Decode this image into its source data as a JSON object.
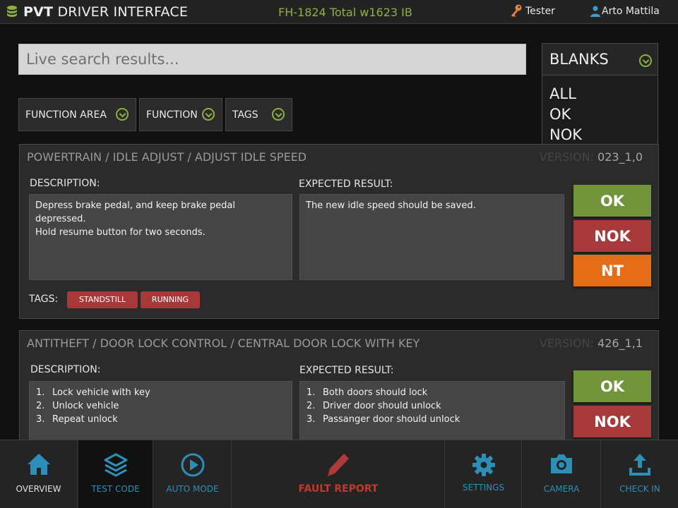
{
  "header": {
    "app_title_bold": "PVT",
    "app_title_rest": "DRIVER INTERFACE",
    "document": "FH-1824 Total w1623 IB",
    "role": "Tester",
    "user": "Arto Mattila"
  },
  "search": {
    "placeholder": "Live search results..."
  },
  "blanks": {
    "selected": "BLANKS",
    "options": [
      "ALL",
      "OK",
      "NOK"
    ]
  },
  "filters": [
    "FUNCTION AREA",
    "FUNCTION",
    "TAGS"
  ],
  "cards": [
    {
      "title": "POWERTRAIN / IDLE ADJUST / ADJUST IDLE SPEED",
      "version_label": "VERSION:",
      "version": "023_1,0",
      "description_label": "DESCRIPTION:",
      "description": [
        "Depress brake pedal, and keep brake pedal depressed.",
        "Hold resume button for two seconds."
      ],
      "expected_label": "EXPECTED RESULT:",
      "expected": "The new idle speed should be saved.",
      "buttons": [
        "OK",
        "NOK",
        "NT"
      ],
      "tags_label": "TAGS:",
      "tags": [
        "STANDSTILL",
        "RUNNING"
      ]
    },
    {
      "title": "ANTITHEFT /  DOOR LOCK CONTROL / CENTRAL DOOR LOCK WITH KEY",
      "version_label": "VERSION:",
      "version": "426_1,1",
      "description_label": "DESCRIPTION:",
      "description_items": [
        {
          "n": "1.",
          "text": "Lock vehicle with key"
        },
        {
          "n": "2.",
          "text": "Unlock vehicle"
        },
        {
          "n": "3.",
          "text": "Repeat unlock"
        }
      ],
      "expected_label": "EXPECTED RESULT:",
      "expected_items": [
        {
          "n": "1.",
          "text": "Both doors should lock"
        },
        {
          "n": "2.",
          "text": "Driver door  should unlock"
        },
        {
          "n": "3.",
          "text": "Passanger door should unlock"
        }
      ],
      "buttons": [
        "OK",
        "NOK"
      ]
    }
  ],
  "nav": [
    {
      "label": "OVERVIEW",
      "icon": "home-icon",
      "color": "#e0e0e0"
    },
    {
      "label": "TEST CODE",
      "icon": "layers-icon",
      "color": "#2d8fb8",
      "active": true
    },
    {
      "label": "AUTO MODE",
      "icon": "play-icon",
      "color": "#2d8fb8"
    },
    {
      "label": "FAULT REPORT",
      "icon": "pencil-icon",
      "color": "#c0392b"
    },
    {
      "label": "SETTINGS",
      "icon": "gear-icon",
      "color": "#2d8fb8"
    },
    {
      "label": "CAMERA",
      "icon": "camera-icon",
      "color": "#2d8fb8"
    },
    {
      "label": "CHECK IN",
      "icon": "upload-icon",
      "color": "#2d8fb8"
    }
  ],
  "colors": {
    "accent_green": "#8db13f",
    "ok": "#72943a",
    "nok": "#a8393b",
    "nt": "#e56d18",
    "nav_blue": "#2d8fb8"
  }
}
